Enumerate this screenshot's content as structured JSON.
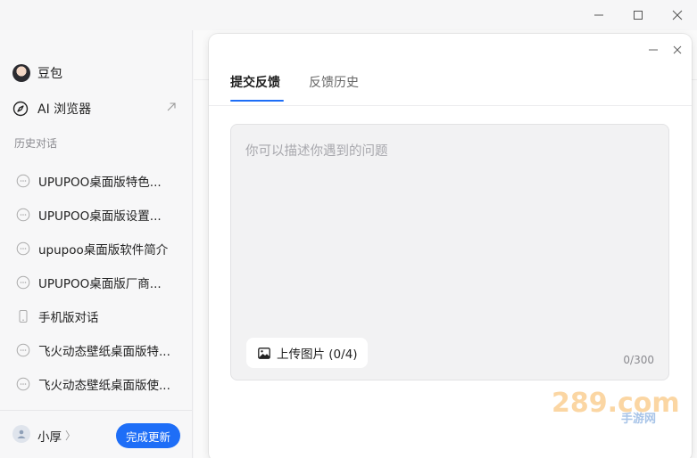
{
  "sidebar": {
    "app_name": "豆包",
    "browser_label": "AI 浏览器",
    "history_title": "历史对话",
    "history": [
      {
        "label": "UPUPOO桌面版特色...",
        "icon": "chat-bubble-icon"
      },
      {
        "label": "UPUPOO桌面版设置...",
        "icon": "chat-bubble-icon"
      },
      {
        "label": "upupoo桌面版软件简介",
        "icon": "chat-bubble-icon"
      },
      {
        "label": "UPUPOO桌面版厂商...",
        "icon": "chat-bubble-icon"
      },
      {
        "label": "手机版对话",
        "icon": "phone-icon"
      },
      {
        "label": "飞火动态壁纸桌面版特...",
        "icon": "chat-bubble-icon"
      },
      {
        "label": "飞火动态壁纸桌面版使...",
        "icon": "chat-bubble-icon"
      }
    ],
    "user_name": "小厚",
    "update_button": "完成更新"
  },
  "dialog": {
    "tabs": [
      {
        "label": "提交反馈",
        "active": true
      },
      {
        "label": "反馈历史",
        "active": false
      }
    ],
    "textarea_placeholder": "你可以描述你遇到的问题",
    "upload_label": "上传图片 (0/4)",
    "char_counter": "0/300"
  },
  "watermark": {
    "main": "289.com",
    "sub": "手游网"
  },
  "colors": {
    "accent": "#1e6ef7",
    "sidebar_bg": "#f7f7f8",
    "textbox_bg": "#f2f2f3"
  }
}
